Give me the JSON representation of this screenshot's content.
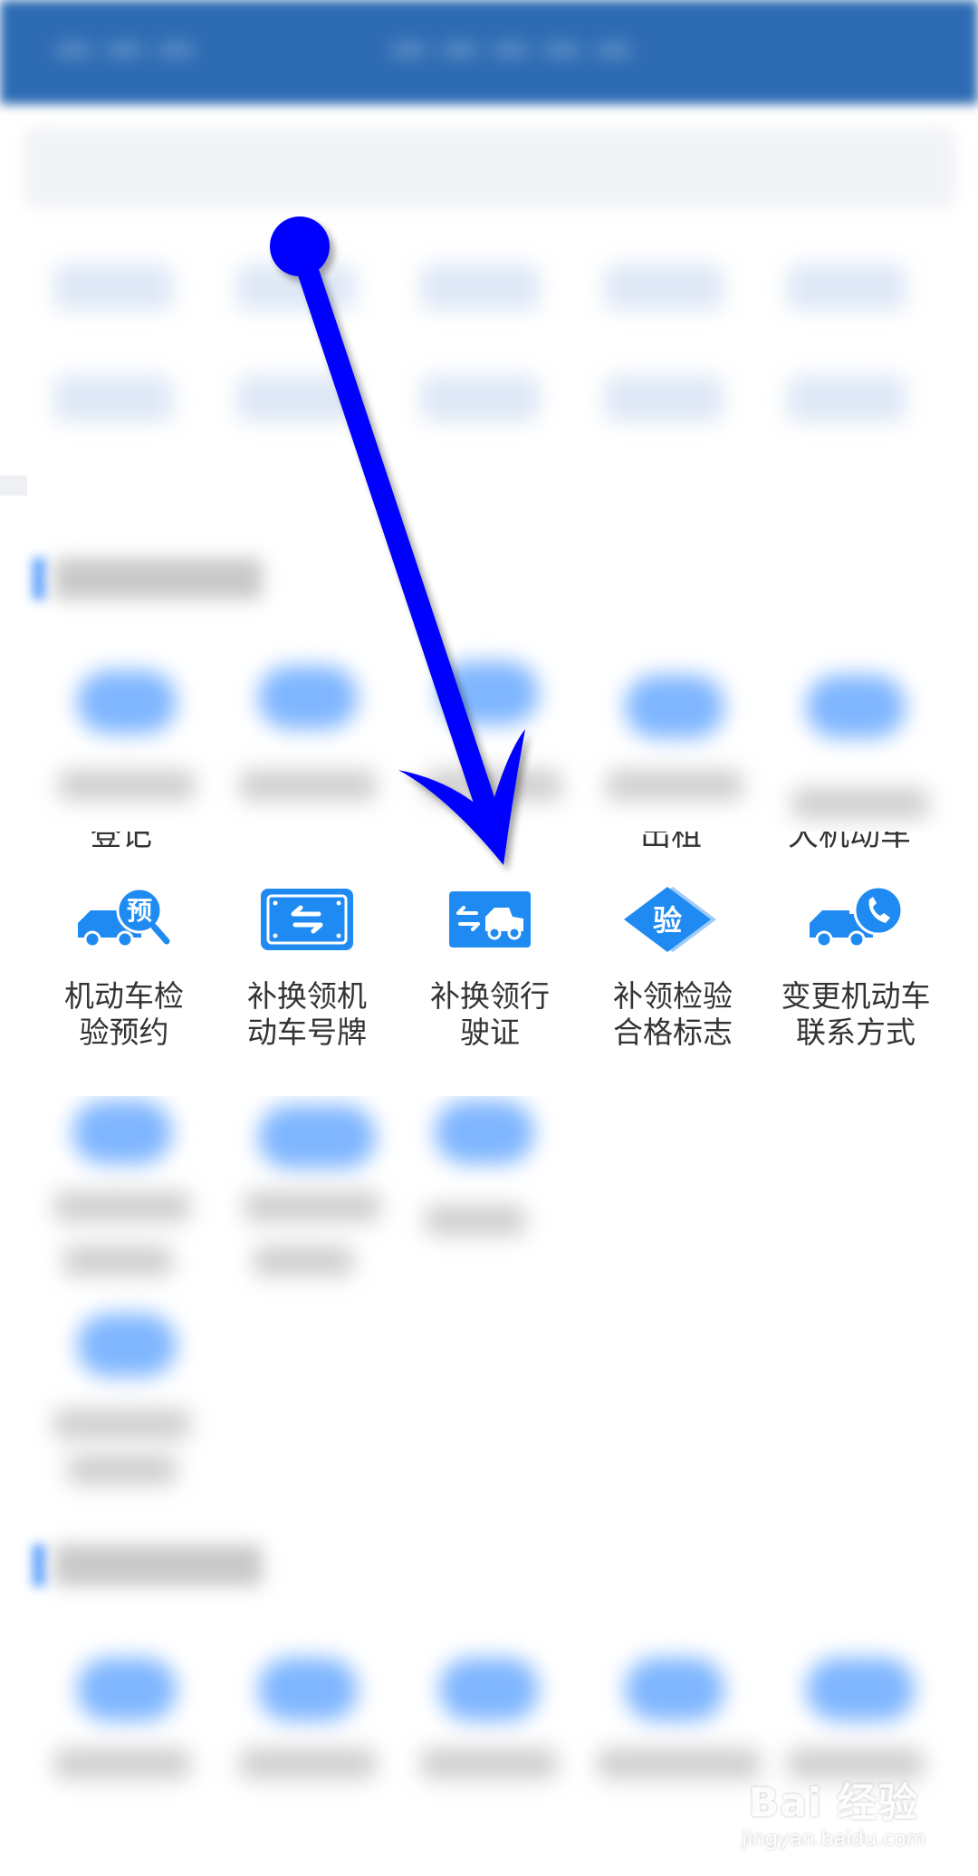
{
  "services": [
    {
      "line1": "机动车检",
      "line2": "验预约",
      "icon": "truck-reservation-icon",
      "badge": "预"
    },
    {
      "line1": "补换领机",
      "line2": "动车号牌",
      "icon": "license-plate-swap-icon"
    },
    {
      "line1": "补换领行",
      "line2": "驶证",
      "icon": "driving-license-swap-icon"
    },
    {
      "line1": "补领检验",
      "line2": "合格标志",
      "icon": "inspection-mark-icon",
      "badge": "验"
    },
    {
      "line1": "变更机动车",
      "line2": "联系方式",
      "icon": "truck-phone-icon"
    }
  ],
  "clipped_above": [
    "登记",
    "出租",
    "大机动车"
  ],
  "colors": {
    "accent": "#1f8bf2",
    "header": "#2d6bb3",
    "arrow": "#0000ff"
  },
  "watermark": {
    "brand": "Bai 经验",
    "url": "jingyan.baidu.com"
  }
}
